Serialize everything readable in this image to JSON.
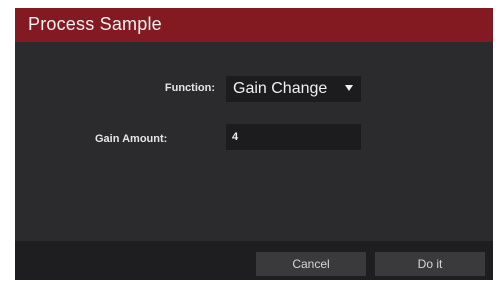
{
  "dialog": {
    "title": "Process Sample",
    "function": {
      "label": "Function:",
      "selected": "Gain Change"
    },
    "gain_amount": {
      "label": "Gain Amount:",
      "value": "4"
    },
    "buttons": {
      "cancel": "Cancel",
      "do_it": "Do it"
    }
  },
  "colors": {
    "titlebar": "#831a22",
    "body": "#2b2b2d",
    "field": "#1c1c1e",
    "footer": "#1e1e20",
    "button": "#3a3a3c"
  },
  "icons": {
    "function_dropdown": "caret-down-icon"
  }
}
